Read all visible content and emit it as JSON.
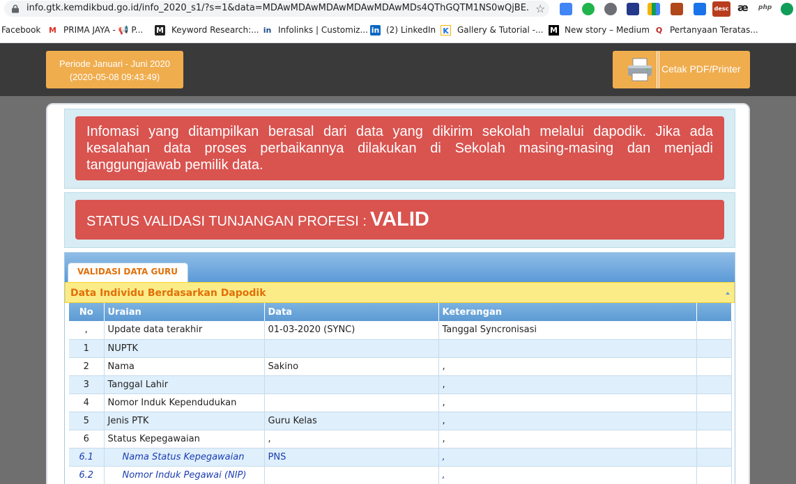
{
  "browser": {
    "url": "info.gtk.kemdikbud.go.id/info_2020_s1/?s=1&data=MDAwMDAwMDAwMDAwMDAwMDs4QThGQTM1NS0wQjBE...",
    "bookmarks": [
      {
        "label": "Facebook",
        "icon": "facebook-icon"
      },
      {
        "label": "PRIMA JAYA - 📢 P...",
        "icon": "gmail-icon"
      },
      {
        "label": "Keyword Research:...",
        "icon": "m-icon"
      },
      {
        "label": "Infolinks | Customiz...",
        "icon": "infolinks-icon"
      },
      {
        "label": "(2) LinkedIn",
        "icon": "linkedin-icon"
      },
      {
        "label": "Gallery & Tutorial -...",
        "icon": "k-icon"
      },
      {
        "label": "New story – Medium",
        "icon": "medium-icon"
      },
      {
        "label": "Pertanyaan Teratas...",
        "icon": "quora-icon"
      }
    ],
    "extensions": {
      "desc_label": "desc",
      "ae_label": "æ",
      "php_label": "php"
    }
  },
  "header": {
    "periode_line1": "Periode Januari - Juni 2020",
    "periode_line2": "(2020-05-08 09:43:49)",
    "print_label": "Cetak PDF/Printer"
  },
  "notice": {
    "text": "Infomasi yang ditampilkan berasal dari data yang dikirim sekolah melalui dapodik. Jika ada kesalahan data proses perbaikannya dilakukan di Sekolah masing-masing dan menjadi tanggungjawab pemilik data."
  },
  "status": {
    "label": "STATUS VALIDASI TUNJANGAN PROFESI :",
    "value": "VALID"
  },
  "tab": {
    "label": "VALIDASI DATA GURU"
  },
  "section": {
    "title": "Data Individu Berdasarkan Dapodik"
  },
  "table": {
    "headers": {
      "no": "No",
      "uraian": "Uraian",
      "data": "Data",
      "keterangan": "Keterangan"
    },
    "rows": [
      {
        "no": ",",
        "uraian": "Update data terakhir",
        "data": "01-03-2020 (SYNC)",
        "keterangan": "Tanggal Syncronisasi"
      },
      {
        "no": "1",
        "uraian": "NUPTK",
        "data": "",
        "keterangan": ""
      },
      {
        "no": "2",
        "uraian": "Nama",
        "data": "Sakino",
        "keterangan": ","
      },
      {
        "no": "3",
        "uraian": "Tanggal Lahir",
        "data": "",
        "keterangan": ","
      },
      {
        "no": "4",
        "uraian": "Nomor Induk Kependudukan",
        "data": "",
        "keterangan": ","
      },
      {
        "no": "5",
        "uraian": "Jenis PTK",
        "data": "Guru Kelas",
        "keterangan": ","
      },
      {
        "no": "6",
        "uraian": "Status Kepegawaian",
        "data": ",",
        "keterangan": ","
      },
      {
        "no": "6.1",
        "uraian": "Nama Status Kepegawaian",
        "data": "PNS",
        "keterangan": ","
      },
      {
        "no": "6.2",
        "uraian": "Nomor Induk Pegawai (NIP)",
        "data": "",
        "keterangan": ","
      }
    ]
  },
  "colors": {
    "accent_orange": "#f0ad4e",
    "alert_red": "#d9534f",
    "header_dark": "#3a3a3a",
    "section_yellow": "#fbec88",
    "tab_orange_text": "#e17009"
  }
}
